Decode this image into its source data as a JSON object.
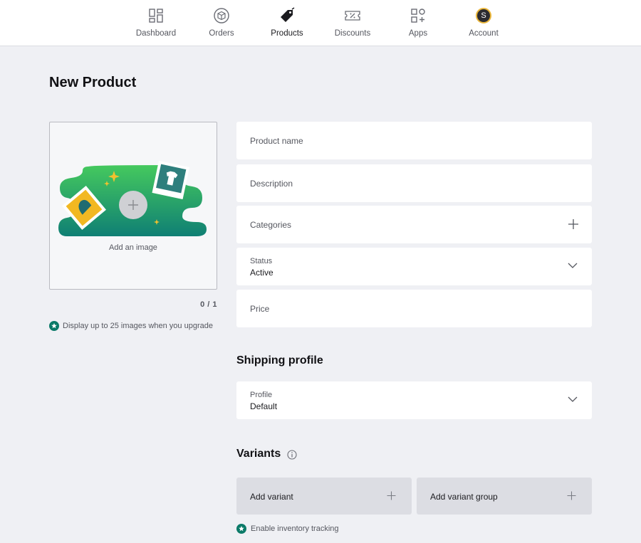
{
  "nav": {
    "items": [
      {
        "label": "Dashboard",
        "icon": "dashboard-icon"
      },
      {
        "label": "Orders",
        "icon": "orders-box-icon"
      },
      {
        "label": "Products",
        "icon": "product-tag-icon",
        "active": true
      },
      {
        "label": "Discounts",
        "icon": "discount-ticket-icon"
      },
      {
        "label": "Apps",
        "icon": "apps-grid-icon"
      },
      {
        "label": "Account",
        "icon": "account-avatar",
        "avatar_letter": "S"
      }
    ]
  },
  "page": {
    "title": "New Product"
  },
  "image_upload": {
    "label": "Add an image",
    "count": "0 / 1",
    "upgrade_note": "Display up to 25 images when you upgrade"
  },
  "form": {
    "product_name_placeholder": "Product name",
    "description_placeholder": "Description",
    "categories_label": "Categories",
    "status": {
      "label": "Status",
      "value": "Active"
    },
    "price_placeholder": "Price"
  },
  "shipping": {
    "title": "Shipping profile",
    "profile": {
      "label": "Profile",
      "value": "Default"
    }
  },
  "variants": {
    "title": "Variants",
    "add_variant": "Add variant",
    "add_variant_group": "Add variant group",
    "inventory_note": "Enable inventory tracking"
  },
  "colors": {
    "accent_green": "#0b7a68",
    "illustration_green": "#3dbf5f",
    "star_yellow": "#f2c12e"
  }
}
